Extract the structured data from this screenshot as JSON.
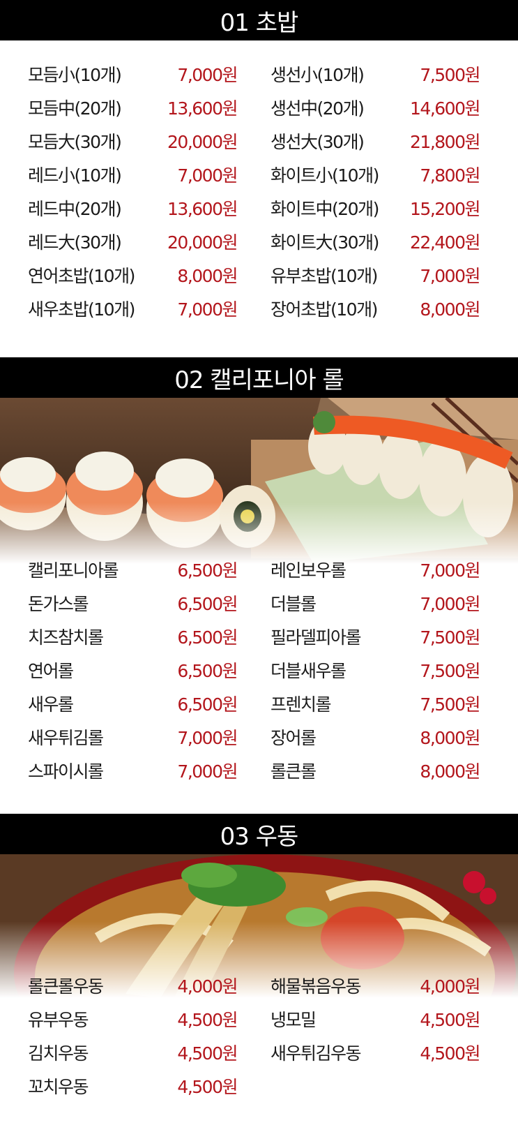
{
  "sections": [
    {
      "title": "01 초밥",
      "items": [
        [
          "모듬小(10개)",
          "7,000원"
        ],
        [
          "생선小(10개)",
          "7,500원"
        ],
        [
          "모듬中(20개)",
          "13,600원"
        ],
        [
          "생선中(20개)",
          "14,600원"
        ],
        [
          "모듬大(30개)",
          "20,000원"
        ],
        [
          "생선大(30개)",
          "21,800원"
        ],
        [
          "레드小(10개)",
          "7,000원"
        ],
        [
          "화이트小(10개)",
          "7,800원"
        ],
        [
          "레드中(20개)",
          "13,600원"
        ],
        [
          "화이트中(20개)",
          "15,200원"
        ],
        [
          "레드大(30개)",
          "20,000원"
        ],
        [
          "화이트大(30개)",
          "22,400원"
        ],
        [
          "연어초밥(10개)",
          "8,000원"
        ],
        [
          "유부초밥(10개)",
          "7,000원"
        ],
        [
          "새우초밥(10개)",
          "7,000원"
        ],
        [
          "장어초밥(10개)",
          "8,000원"
        ]
      ]
    },
    {
      "title": "02 캘리포니아 롤",
      "items": [
        [
          "캘리포니아롤",
          "6,500원"
        ],
        [
          "레인보우롤",
          "7,000원"
        ],
        [
          "돈가스롤",
          "6,500원"
        ],
        [
          "더블롤",
          "7,000원"
        ],
        [
          "치즈참치롤",
          "6,500원"
        ],
        [
          "필라델피아롤",
          "7,500원"
        ],
        [
          "연어롤",
          "6,500원"
        ],
        [
          "더블새우롤",
          "7,500원"
        ],
        [
          "새우롤",
          "6,500원"
        ],
        [
          "프렌치롤",
          "7,500원"
        ],
        [
          "새우튀김롤",
          "7,000원"
        ],
        [
          "장어롤",
          "8,000원"
        ],
        [
          "스파이시롤",
          "7,000원"
        ],
        [
          "롤큰롤",
          "8,000원"
        ]
      ]
    },
    {
      "title": "03 우동",
      "items": [
        [
          "롤큰롤우동",
          "4,000원"
        ],
        [
          "해물볶음우동",
          "4,000원"
        ],
        [
          "유부우동",
          "4,500원"
        ],
        [
          "냉모밀",
          "4,500원"
        ],
        [
          "김치우동",
          "4,500원"
        ],
        [
          "새우튀김우동",
          "4,500원"
        ],
        [
          "꼬치우동",
          "4,500원"
        ]
      ]
    }
  ],
  "colors": {
    "header_bg": "#000000",
    "price": "#b3161c",
    "accent_strip": "#7a0a0a"
  },
  "images": [
    "sushi-roll-photo",
    "udon-bowl-photo"
  ]
}
